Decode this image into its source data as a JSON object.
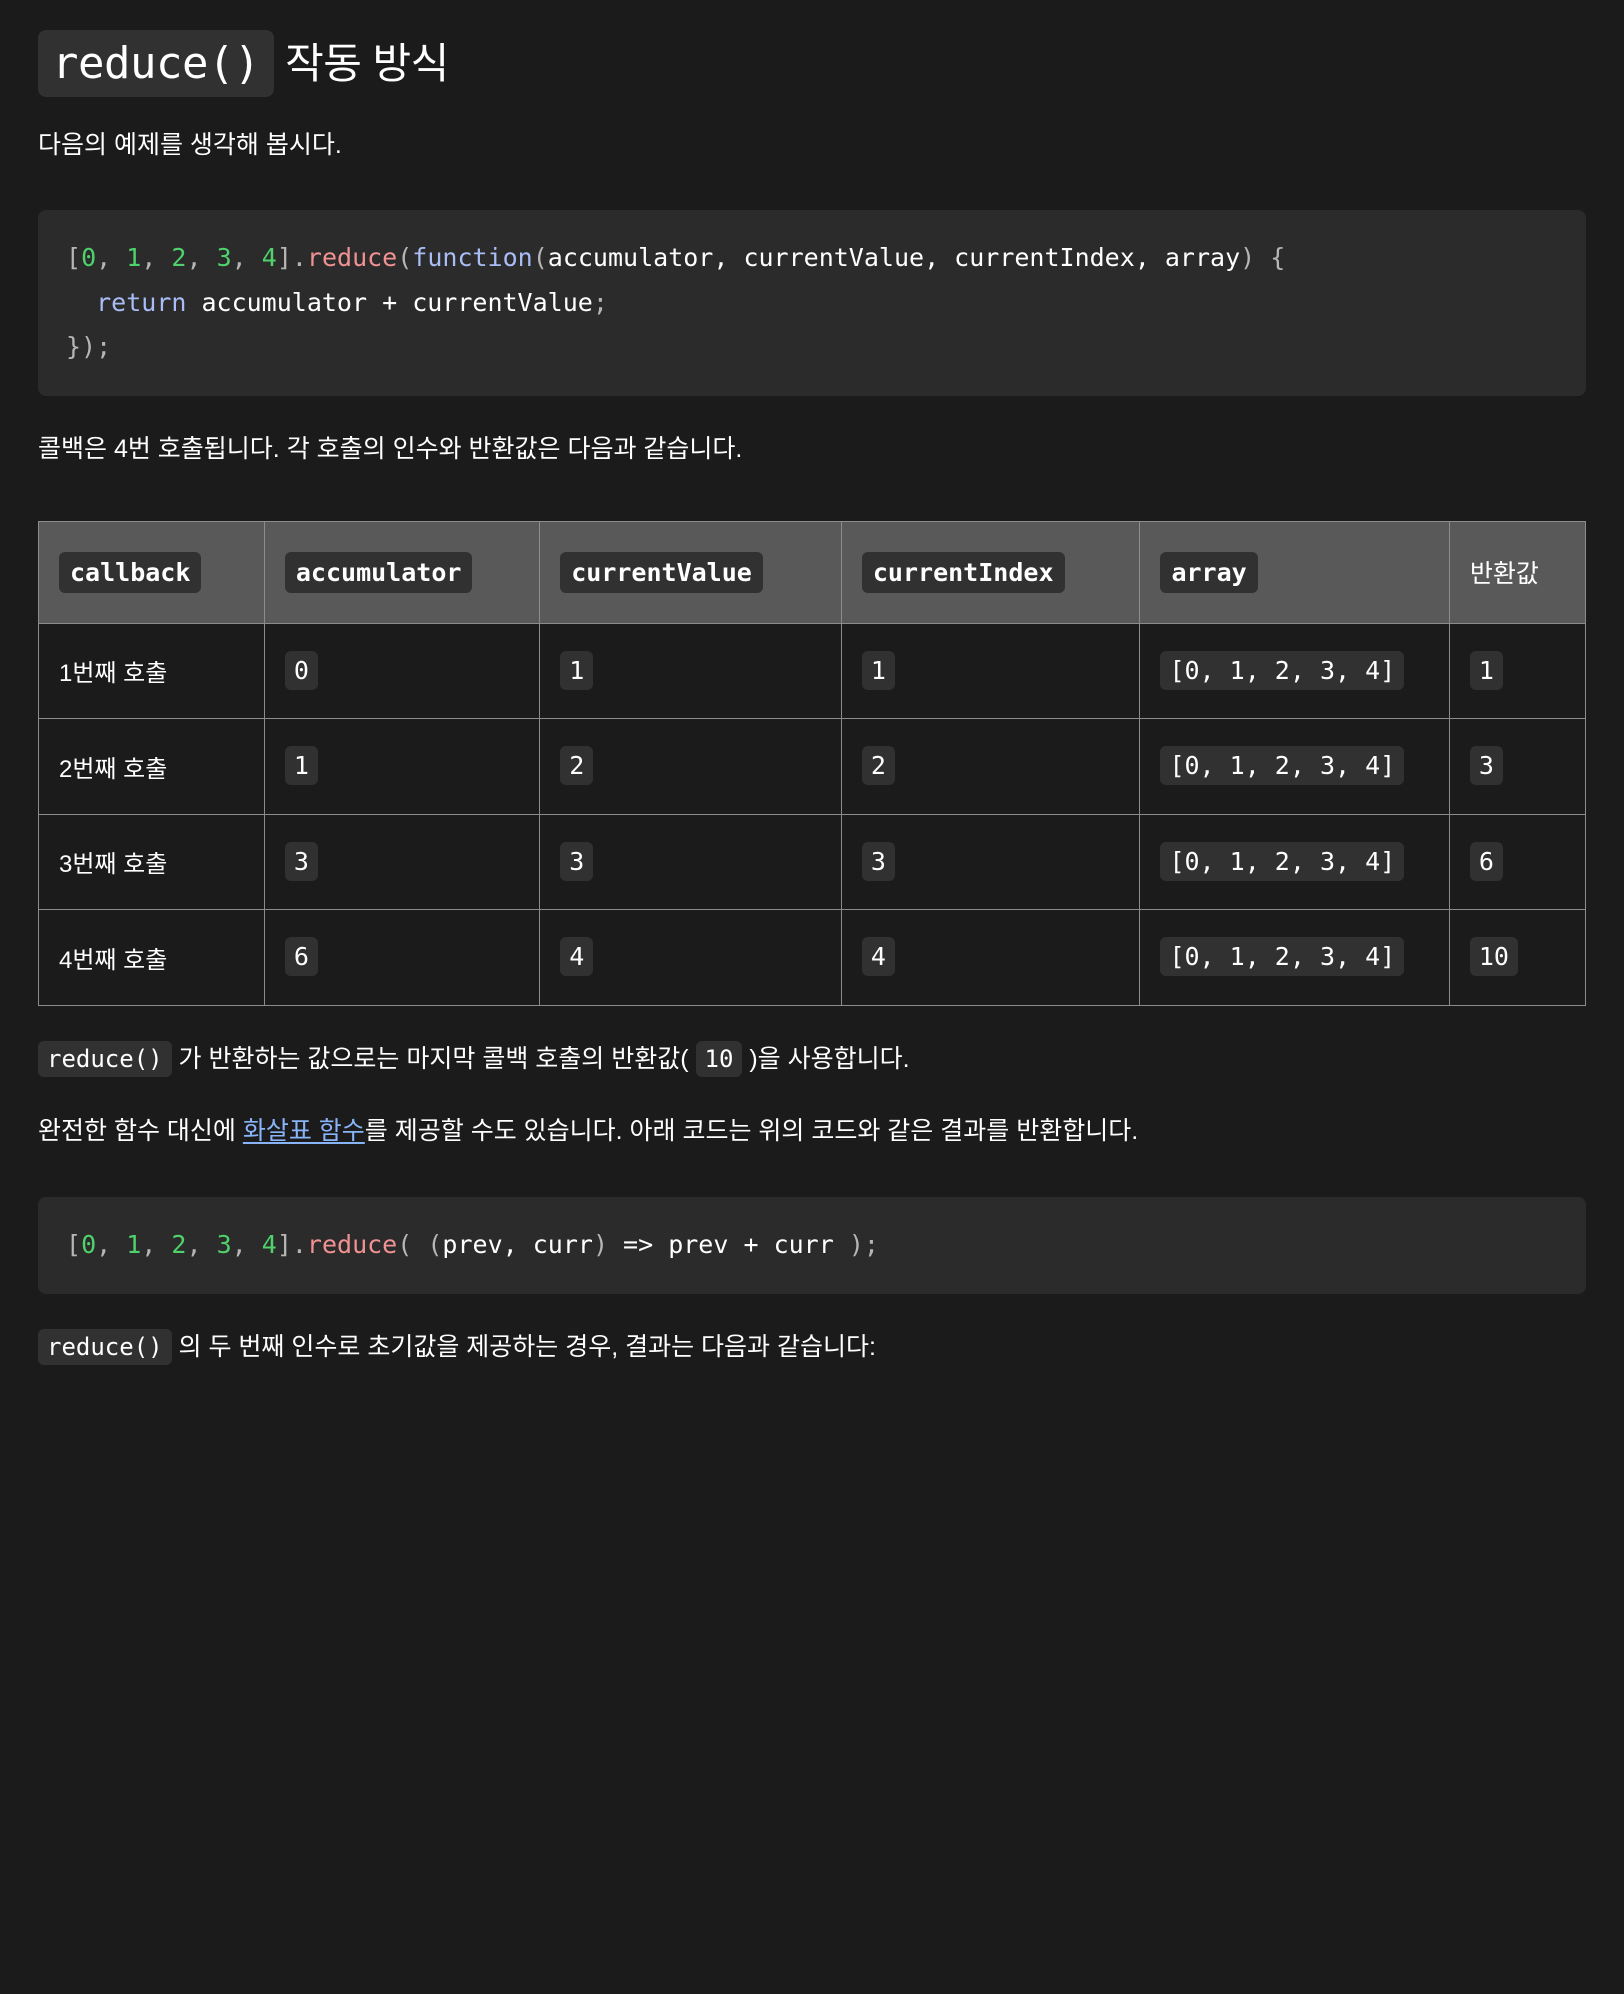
{
  "title": {
    "code": "reduce()",
    "rest": " 작동 방식"
  },
  "intro_paragraph": "다음의 예제를 생각해 봅시다.",
  "code_block_1": {
    "tokens": [
      {
        "t": "[",
        "c": "punc"
      },
      {
        "t": "0",
        "c": "num"
      },
      {
        "t": ", ",
        "c": "punc"
      },
      {
        "t": "1",
        "c": "num"
      },
      {
        "t": ", ",
        "c": "punc"
      },
      {
        "t": "2",
        "c": "num"
      },
      {
        "t": ", ",
        "c": "punc"
      },
      {
        "t": "3",
        "c": "num"
      },
      {
        "t": ", ",
        "c": "punc"
      },
      {
        "t": "4",
        "c": "num"
      },
      {
        "t": "].",
        "c": "punc"
      },
      {
        "t": "reduce",
        "c": "fn"
      },
      {
        "t": "(",
        "c": "punc"
      },
      {
        "t": "function",
        "c": "kw"
      },
      {
        "t": "(",
        "c": "punc"
      },
      {
        "t": "accumulator, currentValue, currentIndex, array",
        "c": "plain"
      },
      {
        "t": ")",
        "c": "punc"
      },
      {
        "t": " ",
        "c": "plain"
      },
      {
        "t": "{",
        "c": "punc"
      },
      {
        "t": "\n  ",
        "c": "plain"
      },
      {
        "t": "return",
        "c": "kw"
      },
      {
        "t": " accumulator + currentValue",
        "c": "plain"
      },
      {
        "t": ";",
        "c": "punc"
      },
      {
        "t": "\n",
        "c": "plain"
      },
      {
        "t": "});",
        "c": "punc"
      }
    ],
    "plain_text": "[0, 1, 2, 3, 4].reduce(function(accumulator, currentValue, currentIndex, array) {\n  return accumulator + currentValue;\n});"
  },
  "callback_paragraph": "콜백은 4번 호출됩니다. 각 호출의 인수와 반환값은 다음과 같습니다.",
  "table": {
    "headers": [
      {
        "label": "callback",
        "code": true
      },
      {
        "label": "accumulator",
        "code": true
      },
      {
        "label": "currentValue",
        "code": true
      },
      {
        "label": "currentIndex",
        "code": true
      },
      {
        "label": "array",
        "code": true
      },
      {
        "label": "반환값",
        "code": false
      }
    ],
    "rows": [
      {
        "callback": "1번째 호출",
        "accumulator": "0",
        "currentValue": "1",
        "currentIndex": "1",
        "array": "[0, 1, 2, 3, 4]",
        "returnValue": "1"
      },
      {
        "callback": "2번째 호출",
        "accumulator": "1",
        "currentValue": "2",
        "currentIndex": "2",
        "array": "[0, 1, 2, 3, 4]",
        "returnValue": "3"
      },
      {
        "callback": "3번째 호출",
        "accumulator": "3",
        "currentValue": "3",
        "currentIndex": "3",
        "array": "[0, 1, 2, 3, 4]",
        "returnValue": "6"
      },
      {
        "callback": "4번째 호출",
        "accumulator": "6",
        "currentValue": "4",
        "currentIndex": "4",
        "array": "[0, 1, 2, 3, 4]",
        "returnValue": "10"
      }
    ]
  },
  "result_paragraph": {
    "code_1": "reduce()",
    "text_1": " 가 반환하는 값으로는 마지막 콜백 호출의 반환값( ",
    "code_2": "10",
    "text_2": " )을 사용합니다."
  },
  "arrow_paragraph": {
    "text_1": "완전한 함수 대신에 ",
    "link": "화살표 함수",
    "text_2": "를 제공할 수도 있습니다. 아래 코드는 위의 코드와 같은 결과를 반환합니다."
  },
  "code_block_2": {
    "tokens": [
      {
        "t": "[",
        "c": "punc"
      },
      {
        "t": "0",
        "c": "num"
      },
      {
        "t": ", ",
        "c": "punc"
      },
      {
        "t": "1",
        "c": "num"
      },
      {
        "t": ", ",
        "c": "punc"
      },
      {
        "t": "2",
        "c": "num"
      },
      {
        "t": ", ",
        "c": "punc"
      },
      {
        "t": "3",
        "c": "num"
      },
      {
        "t": ", ",
        "c": "punc"
      },
      {
        "t": "4",
        "c": "num"
      },
      {
        "t": "].",
        "c": "punc"
      },
      {
        "t": "reduce",
        "c": "fn"
      },
      {
        "t": "(",
        "c": "punc"
      },
      {
        "t": " ",
        "c": "plain"
      },
      {
        "t": "(",
        "c": "punc"
      },
      {
        "t": "prev, curr",
        "c": "plain"
      },
      {
        "t": ")",
        "c": "punc"
      },
      {
        "t": " => prev + curr ",
        "c": "plain"
      },
      {
        "t": ");",
        "c": "punc"
      }
    ],
    "plain_text": "[0, 1, 2, 3, 4].reduce( (prev, curr) => prev + curr );"
  },
  "initial_paragraph": {
    "code_1": "reduce()",
    "text_1": " 의 두 번째 인수로 초기값을 제공하는 경우, 결과는 다음과 같습니다:"
  },
  "colors": {
    "background": "#1b1b1b",
    "code_block_bg": "#2b2b2b",
    "chip_bg": "#313131",
    "table_header_bg": "#595959",
    "table_border": "#8c8c8c",
    "text": "#ffffff",
    "link": "#8ab4f8",
    "token_number": "#4fd16b",
    "token_function": "#f09292",
    "token_keyword": "#a9bcf5",
    "token_punct": "#b6b6b6"
  }
}
